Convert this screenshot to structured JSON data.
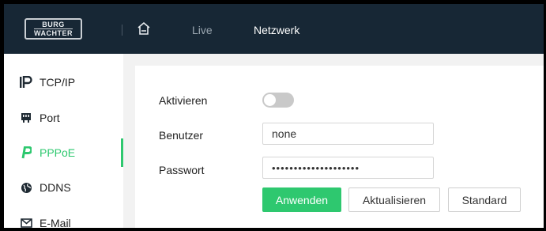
{
  "header": {
    "logo_line1": "BURG",
    "logo_line2": "WACHTER",
    "nav": {
      "live": "Live",
      "netzwerk": "Netzwerk"
    }
  },
  "sidebar": {
    "items": [
      {
        "label": "TCP/IP",
        "icon": "ip-icon"
      },
      {
        "label": "Port",
        "icon": "port-icon"
      },
      {
        "label": "PPPoE",
        "icon": "pppoe-icon",
        "active": true
      },
      {
        "label": "DDNS",
        "icon": "ddns-icon"
      },
      {
        "label": "E-Mail",
        "icon": "mail-icon"
      }
    ]
  },
  "form": {
    "aktivieren_label": "Aktivieren",
    "aktivieren_on": false,
    "benutzer_label": "Benutzer",
    "benutzer_value": "none",
    "passwort_label": "Passwort",
    "passwort_value": "••••••••••••••••••••"
  },
  "buttons": {
    "anwenden": "Anwenden",
    "aktualisieren": "Aktualisieren",
    "standard": "Standard"
  },
  "colors": {
    "accent": "#2ec86f",
    "topbar": "#172735"
  }
}
